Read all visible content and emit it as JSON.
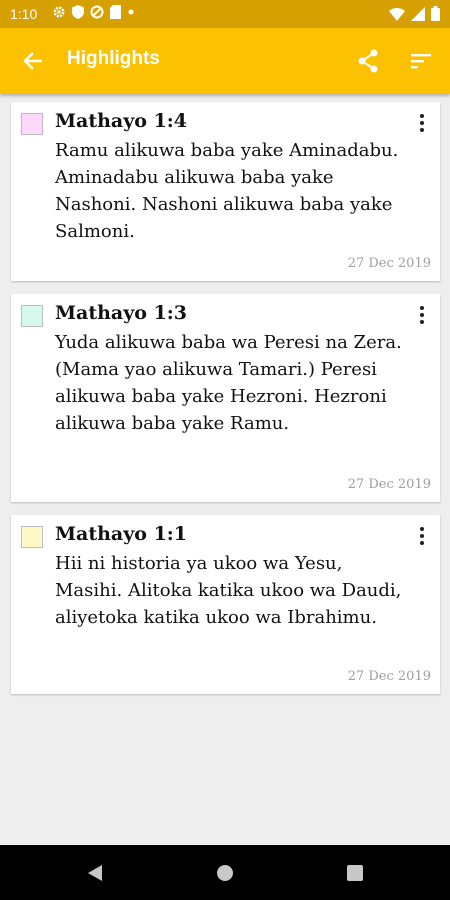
{
  "status_bar": {
    "time": "1:10"
  },
  "app_bar": {
    "title": "Highlights"
  },
  "highlights": [
    {
      "reference": "Mathayo 1:4",
      "text": "Ramu alikuwa baba yake Aminadabu. Aminadabu alikuwa baba yake Nashoni. Nashoni alikuwa baba yake Salmoni.",
      "date": "27 Dec 2019",
      "color": "#fdd8fb"
    },
    {
      "reference": "Mathayo 1:3",
      "text": "Yuda alikuwa baba wa Peresi na Zera. (Mama yao alikuwa Tamari.) Peresi alikuwa baba yake Hezroni. Hezroni alikuwa baba yake Ramu.",
      "date": "27 Dec 2019",
      "color": "#d7f8ec"
    },
    {
      "reference": "Mathayo 1:1",
      "text": "Hii ni historia ya ukoo wa Yesu, Masihi. Alitoka katika ukoo wa Daudi, aliyetoka katika ukoo wa Ibrahimu.",
      "date": "27 Dec 2019",
      "color": "#fff9c8"
    }
  ],
  "colors": {
    "app_bar": "#fcc100",
    "status_bar": "#d6a000",
    "background": "#eeeeee"
  }
}
